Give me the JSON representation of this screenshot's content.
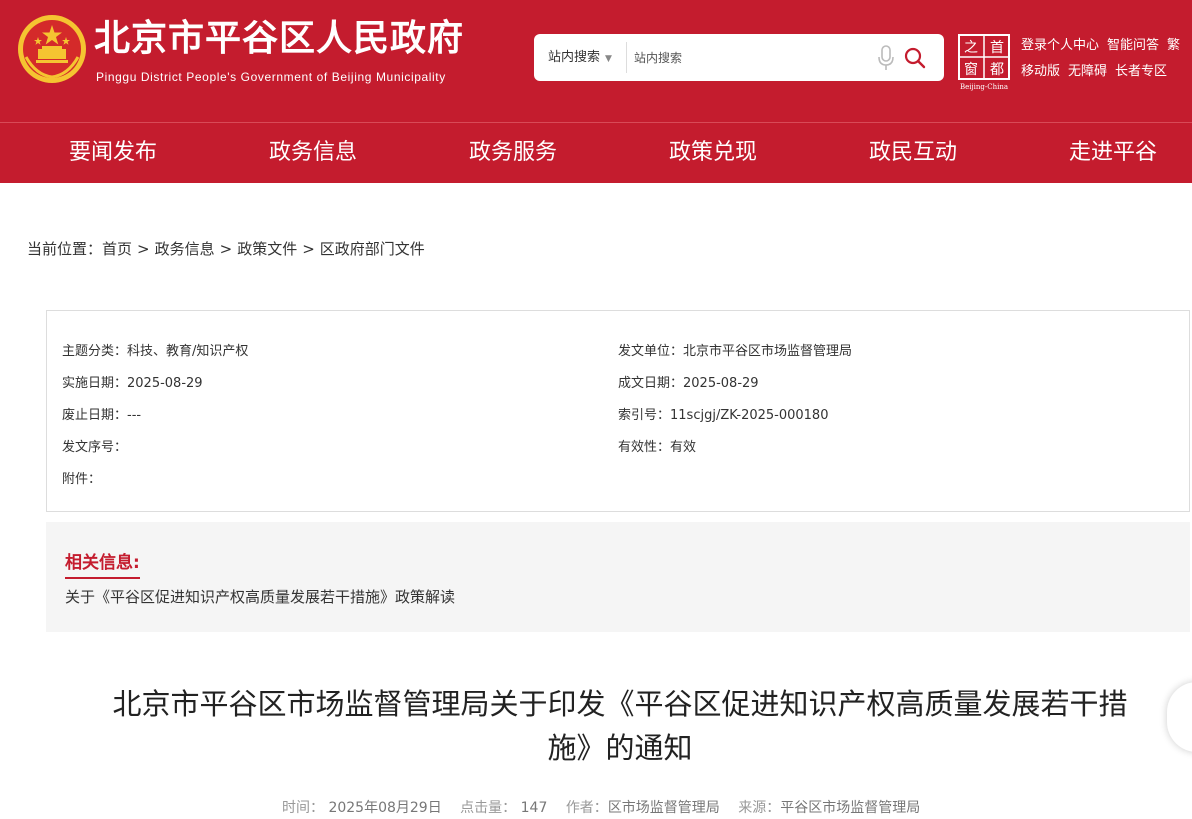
{
  "header": {
    "title": "北京市平谷区人民政府",
    "subtitle": "Pinggu District People's Government of Beijing Municipality",
    "search_scope": "站内搜索",
    "search_placeholder": "站内搜索",
    "logo_chars": [
      "之",
      "首",
      "窗",
      "都"
    ],
    "logo_caption": "Beijing-China",
    "links_row1": [
      "登录个人中心",
      "智能问答",
      "繁"
    ],
    "links_row2": [
      "移动版",
      "无障碍",
      "长者专区"
    ]
  },
  "nav": [
    "要闻发布",
    "政务信息",
    "政务服务",
    "政策兑现",
    "政民互动",
    "走进平谷"
  ],
  "breadcrumb": {
    "prefix": "当前位置：",
    "items": [
      "首页",
      "政务信息",
      "政策文件",
      "区政府部门文件"
    ],
    "separator": ">"
  },
  "info": {
    "left": [
      "主题分类：科技、教育/知识产权",
      "实施日期：2025-08-29",
      "废止日期：---",
      "发文序号：",
      "附件："
    ],
    "right": [
      "发文单位：北京市平谷区市场监督管理局",
      "成文日期：2025-08-29",
      "索引号：11scjgj/ZK-2025-000180",
      "有效性：有效"
    ]
  },
  "related": {
    "title": "相关信息:",
    "link": "关于《平谷区促进知识产权高质量发展若干措施》政策解读"
  },
  "article": {
    "title_line1": "北京市平谷区市场监督管理局关于印发《平谷区促进知识产权高质量发展若干措",
    "title_line2": "施》的通知",
    "time_label": "时间：",
    "time_value": "2025年08月29日",
    "hits_label": "点击量：",
    "hits_value": "147",
    "author_label": "作者：",
    "author_value": "区市场监督管理局",
    "source_label": "来源：",
    "source_value": "平谷区市场监督管理局"
  },
  "colors": {
    "brand_red": "#c41c2e",
    "emblem_gold": "#f5c431"
  }
}
